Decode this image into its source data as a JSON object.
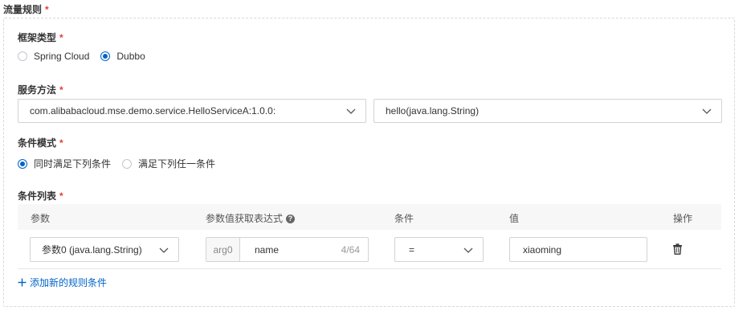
{
  "header": {
    "title": "流量规则"
  },
  "framework": {
    "label": "框架类型",
    "options": [
      {
        "label": "Spring Cloud",
        "checked": false
      },
      {
        "label": "Dubbo",
        "checked": true
      }
    ]
  },
  "service_method": {
    "label": "服务方法",
    "service_value": "com.alibabacloud.mse.demo.service.HelloServiceA:1.0.0:",
    "method_value": "hello(java.lang.String)"
  },
  "condition_mode": {
    "label": "条件模式",
    "options": [
      {
        "label": "同时满足下列条件",
        "checked": true
      },
      {
        "label": "满足下列任一条件",
        "checked": false
      }
    ]
  },
  "condition_list": {
    "label": "条件列表",
    "columns": [
      "参数",
      "参数值获取表达式",
      "条件",
      "值",
      "操作"
    ],
    "rows": [
      {
        "param": "参数0 (java.lang.String)",
        "expr_prefix": "arg0",
        "expr_value": "name",
        "expr_count": "4/64",
        "condition": "=",
        "value": "xiaoming"
      }
    ],
    "add_label": "添加新的规则条件"
  },
  "colors": {
    "primary": "#0064c8",
    "required": "#e23c39"
  }
}
